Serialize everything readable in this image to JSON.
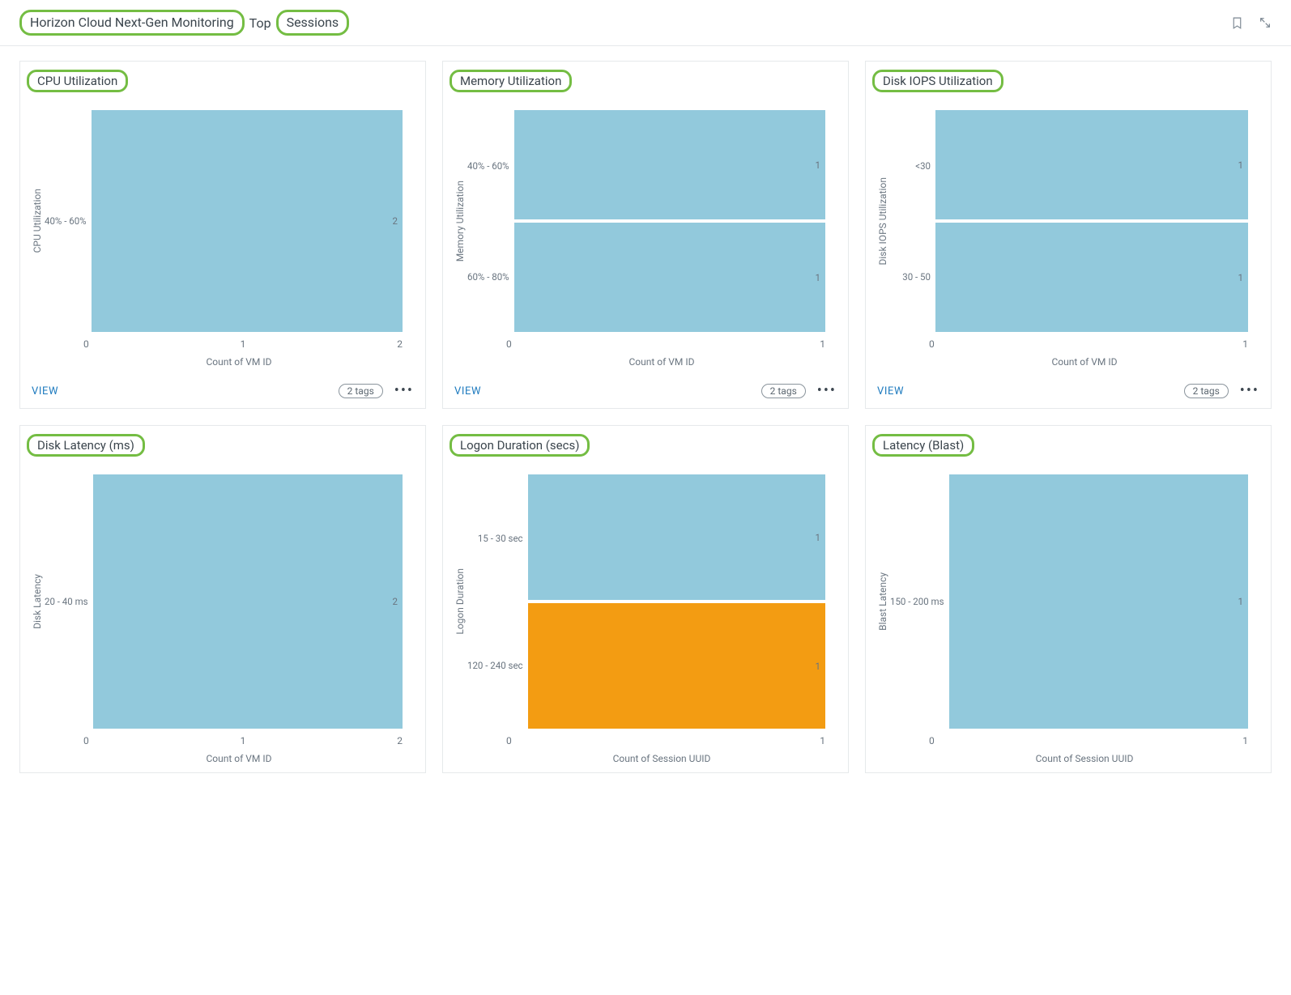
{
  "header": {
    "breadcrumb_main": "Horizon Cloud Next-Gen Monitoring",
    "breadcrumb_separator": "Top",
    "breadcrumb_page": "Sessions"
  },
  "footer_common": {
    "view_label": "VIEW",
    "tags_label": "2 tags"
  },
  "panels": [
    {
      "key": "cpu",
      "title": "CPU Utilization",
      "ylabel": "CPU Utilization",
      "xlabel": "Count of VM ID",
      "xticks": [
        "0",
        "1",
        "2"
      ],
      "has_footer": true,
      "rows": [
        {
          "label": "40% - 60%",
          "value": 2,
          "value_label": "2",
          "width_frac": 1.0,
          "color": "blue"
        }
      ]
    },
    {
      "key": "mem",
      "title": "Memory Utilization",
      "ylabel": "Memory Utilization",
      "xlabel": "Count of VM ID",
      "xticks": [
        "0",
        "1"
      ],
      "has_footer": true,
      "rows": [
        {
          "label": "40% - 60%",
          "value": 1,
          "value_label": "1",
          "width_frac": 1.0,
          "color": "blue"
        },
        {
          "label": "60% - 80%",
          "value": 1,
          "value_label": "1",
          "width_frac": 1.0,
          "color": "blue"
        }
      ]
    },
    {
      "key": "iops",
      "title": "Disk IOPS Utilization",
      "ylabel": "Disk IOPS Utilization",
      "xlabel": "Count of VM ID",
      "xticks": [
        "0",
        "1"
      ],
      "has_footer": true,
      "rows": [
        {
          "label": "<30",
          "value": 1,
          "value_label": "1",
          "width_frac": 1.0,
          "color": "blue"
        },
        {
          "label": "30 - 50",
          "value": 1,
          "value_label": "1",
          "width_frac": 1.0,
          "color": "blue"
        }
      ]
    },
    {
      "key": "dlat",
      "title": "Disk Latency (ms)",
      "ylabel": "Disk Latency",
      "xlabel": "Count of VM ID",
      "xticks": [
        "0",
        "1",
        "2"
      ],
      "has_footer": false,
      "rows": [
        {
          "label": "20 - 40 ms",
          "value": 2,
          "value_label": "2",
          "width_frac": 1.0,
          "color": "blue"
        }
      ]
    },
    {
      "key": "logon",
      "title": "Logon Duration (secs)",
      "ylabel": "Logon Duration",
      "xlabel": "Count of Session UUID",
      "xticks": [
        "0",
        "1"
      ],
      "has_footer": false,
      "rows": [
        {
          "label": "15 - 30 sec",
          "value": 1,
          "value_label": "1",
          "width_frac": 1.0,
          "color": "blue"
        },
        {
          "label": "120 - 240 sec",
          "value": 1,
          "value_label": "1",
          "width_frac": 1.0,
          "color": "orange"
        }
      ]
    },
    {
      "key": "blast",
      "title": "Latency (Blast)",
      "ylabel": "Blast Latency",
      "xlabel": "Count of Session UUID",
      "xticks": [
        "0",
        "1"
      ],
      "has_footer": false,
      "rows": [
        {
          "label": "150 - 200 ms",
          "value": 1,
          "value_label": "1",
          "width_frac": 1.0,
          "color": "blue"
        }
      ]
    }
  ],
  "chart_data": [
    {
      "type": "bar",
      "orientation": "horizontal",
      "title": "CPU Utilization",
      "xlabel": "Count of VM ID",
      "ylabel": "CPU Utilization",
      "xlim": [
        0,
        2
      ],
      "categories": [
        "40% - 60%"
      ],
      "values": [
        2
      ]
    },
    {
      "type": "bar",
      "orientation": "horizontal",
      "title": "Memory Utilization",
      "xlabel": "Count of VM ID",
      "ylabel": "Memory Utilization",
      "xlim": [
        0,
        1
      ],
      "categories": [
        "40% - 60%",
        "60% - 80%"
      ],
      "values": [
        1,
        1
      ]
    },
    {
      "type": "bar",
      "orientation": "horizontal",
      "title": "Disk IOPS Utilization",
      "xlabel": "Count of VM ID",
      "ylabel": "Disk IOPS Utilization",
      "xlim": [
        0,
        1
      ],
      "categories": [
        "<30",
        "30 - 50"
      ],
      "values": [
        1,
        1
      ]
    },
    {
      "type": "bar",
      "orientation": "horizontal",
      "title": "Disk Latency (ms)",
      "xlabel": "Count of VM ID",
      "ylabel": "Disk Latency",
      "xlim": [
        0,
        2
      ],
      "categories": [
        "20 - 40 ms"
      ],
      "values": [
        2
      ]
    },
    {
      "type": "bar",
      "orientation": "horizontal",
      "title": "Logon Duration (secs)",
      "xlabel": "Count of Session UUID",
      "ylabel": "Logon Duration",
      "xlim": [
        0,
        1
      ],
      "categories": [
        "15 - 30 sec",
        "120 - 240 sec"
      ],
      "values": [
        1,
        1
      ],
      "colors": [
        "#92c9dc",
        "#f39c12"
      ]
    },
    {
      "type": "bar",
      "orientation": "horizontal",
      "title": "Latency (Blast)",
      "xlabel": "Count of Session UUID",
      "ylabel": "Blast Latency",
      "xlim": [
        0,
        1
      ],
      "categories": [
        "150 - 200 ms"
      ],
      "values": [
        1
      ]
    }
  ]
}
